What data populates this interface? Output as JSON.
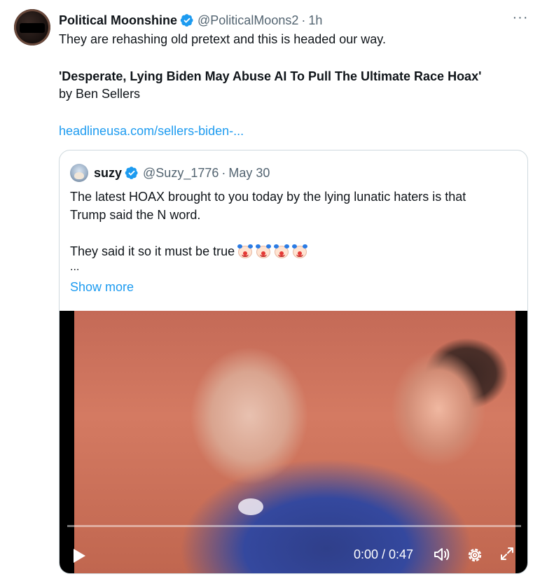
{
  "tweet": {
    "author_name": "Political Moonshine",
    "author_handle": "@PoliticalMoons2",
    "separator": "·",
    "time": "1h",
    "more_label": "···",
    "text_line1": "They are rehashing old pretext and this is headed our way.",
    "headline": "'Desperate, Lying Biden May Abuse AI To Pull The Ultimate Race Hoax'",
    "byline": "by Ben Sellers",
    "link": "headlineusa.com/sellers-biden-..."
  },
  "quote": {
    "author_name": "suzy",
    "author_handle": "@Suzy_1776",
    "separator": "·",
    "time": "May 30",
    "text_line1": "The latest HOAX brought to you today by the lying lunatic haters is that",
    "text_line2": "Trump said the N word.",
    "text_line3": "They said it so it must be true",
    "ellipsis": "...",
    "show_more": "Show more",
    "emoji_count": 4
  },
  "video": {
    "time_display": "0:00 / 0:47",
    "progress": 0.0
  },
  "colors": {
    "accent": "#1d9bf0",
    "secondary_text": "#536471",
    "border": "#cfd9de"
  },
  "icons": {
    "verified": "verified-badge-icon",
    "more": "more-icon",
    "play": "play-icon",
    "volume": "volume-icon",
    "settings": "gear-icon",
    "fullscreen": "expand-icon"
  }
}
